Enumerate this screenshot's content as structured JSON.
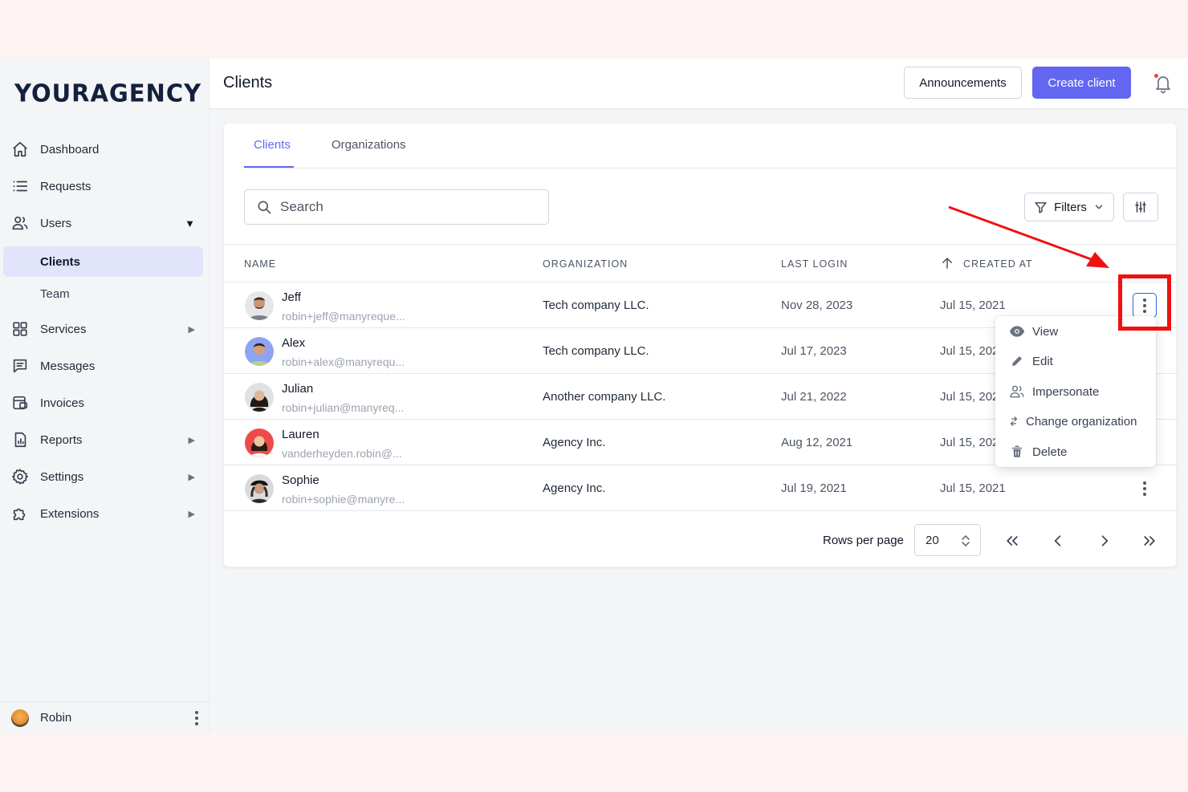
{
  "brand": {
    "logo_text": "YOURAGENCY"
  },
  "sidebar": {
    "items": [
      {
        "label": "Dashboard",
        "icon": "home-icon"
      },
      {
        "label": "Requests",
        "icon": "list-icon"
      },
      {
        "label": "Users",
        "icon": "users-icon",
        "expanded": true
      },
      {
        "label": "Services",
        "icon": "grid-icon"
      },
      {
        "label": "Messages",
        "icon": "message-icon"
      },
      {
        "label": "Invoices",
        "icon": "invoice-icon"
      },
      {
        "label": "Reports",
        "icon": "report-icon"
      },
      {
        "label": "Settings",
        "icon": "gear-icon"
      },
      {
        "label": "Extensions",
        "icon": "puzzle-icon"
      }
    ],
    "users_sub": [
      {
        "label": "Clients",
        "active": true
      },
      {
        "label": "Team",
        "active": false
      }
    ],
    "footer_user": "Robin"
  },
  "header": {
    "title": "Clients",
    "announcements_label": "Announcements",
    "create_label": "Create client"
  },
  "tabs": [
    {
      "label": "Clients",
      "active": true
    },
    {
      "label": "Organizations",
      "active": false
    }
  ],
  "search": {
    "placeholder": "Search"
  },
  "toolbar": {
    "filters_label": "Filters"
  },
  "table": {
    "columns": [
      "NAME",
      "ORGANIZATION",
      "LAST LOGIN",
      "CREATED AT"
    ],
    "rows": [
      {
        "name": "Jeff",
        "email": "robin+jeff@manyreque...",
        "organization": "Tech company LLC.",
        "last_login": "Nov 28, 2023",
        "created_at": "Jul 15, 2021"
      },
      {
        "name": "Alex",
        "email": "robin+alex@manyrequ...",
        "organization": "Tech company LLC.",
        "last_login": "Jul 17, 2023",
        "created_at": "Jul 15, 202"
      },
      {
        "name": "Julian",
        "email": "robin+julian@manyreq...",
        "organization": "Another company LLC.",
        "last_login": "Jul 21, 2022",
        "created_at": "Jul 15, 202"
      },
      {
        "name": "Lauren",
        "email": "vanderheyden.robin@...",
        "organization": "Agency Inc.",
        "last_login": "Aug 12, 2021",
        "created_at": "Jul 15, 202"
      },
      {
        "name": "Sophie",
        "email": "robin+sophie@manyre...",
        "organization": "Agency Inc.",
        "last_login": "Jul 19, 2021",
        "created_at": "Jul 15, 2021"
      }
    ]
  },
  "pagination": {
    "rows_per_page_label": "Rows per page",
    "rows_per_page_value": "20"
  },
  "row_menu": {
    "items": [
      {
        "label": "View",
        "icon": "eye-icon"
      },
      {
        "label": "Edit",
        "icon": "pencil-icon"
      },
      {
        "label": "Impersonate",
        "icon": "users-icon"
      },
      {
        "label": "Change organization",
        "icon": "swap-icon"
      },
      {
        "label": "Delete",
        "icon": "trash-icon"
      }
    ]
  },
  "colors": {
    "accent": "#6366f1",
    "highlight": "#ef1111",
    "sidebar_active": "#e2e4fb"
  }
}
